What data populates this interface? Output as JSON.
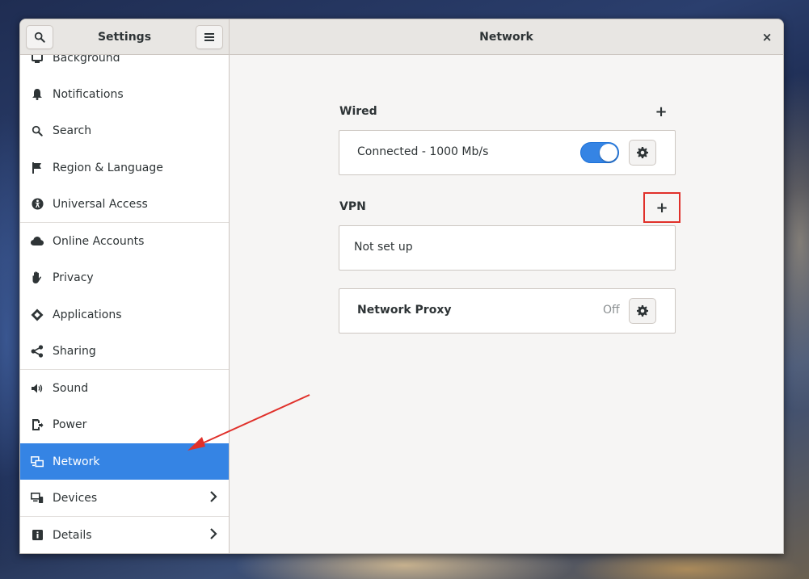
{
  "window": {
    "sidebar_title": "Settings",
    "content_title": "Network",
    "close_glyph": "×"
  },
  "sidebar": {
    "items": [
      {
        "label": "Background",
        "icon": "background-icon"
      },
      {
        "label": "Notifications",
        "icon": "bell-icon"
      },
      {
        "label": "Search",
        "icon": "search-icon"
      },
      {
        "label": "Region & Language",
        "icon": "flag-icon"
      },
      {
        "label": "Universal Access",
        "icon": "accessibility-icon"
      },
      {
        "label": "Online Accounts",
        "icon": "cloud-icon"
      },
      {
        "label": "Privacy",
        "icon": "hand-icon"
      },
      {
        "label": "Applications",
        "icon": "applications-icon"
      },
      {
        "label": "Sharing",
        "icon": "share-icon"
      },
      {
        "label": "Sound",
        "icon": "speaker-icon"
      },
      {
        "label": "Power",
        "icon": "power-icon"
      },
      {
        "label": "Network",
        "icon": "network-icon",
        "active": true
      },
      {
        "label": "Devices",
        "icon": "devices-icon",
        "chevron": true
      },
      {
        "label": "Details",
        "icon": "info-icon",
        "chevron": true
      }
    ]
  },
  "wired": {
    "title": "Wired",
    "add_glyph": "+",
    "status": "Connected - 1000 Mb/s",
    "switch_on": true
  },
  "vpn": {
    "title": "VPN",
    "add_glyph": "+",
    "status": "Not set up"
  },
  "proxy": {
    "title": "Network Proxy",
    "status": "Off"
  },
  "colors": {
    "accent": "#3584e4",
    "highlight_box": "#e0302a",
    "arrow": "#e0302a"
  }
}
